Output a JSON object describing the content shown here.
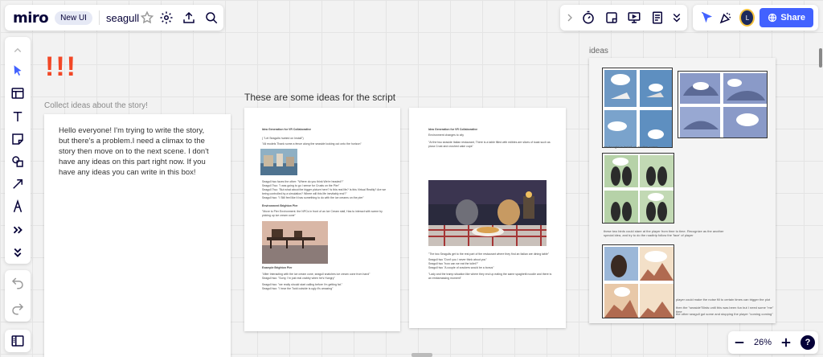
{
  "header": {
    "logo": "miro",
    "badge": "New UI",
    "board_name": "seagull"
  },
  "share": {
    "label": "Share"
  },
  "avatar": {
    "initial": "L"
  },
  "zoom": {
    "level": "26%"
  },
  "help": {
    "label": "?"
  },
  "canvas": {
    "exclaim": "!!!",
    "collect_caption": "Collect ideas about the story!",
    "script_caption": "These are some ideas for the script",
    "ideas_caption": "ideas",
    "sticky_text": "Hello everyone! I'm trying to write the story, but there's a problem.I need a climax to the story then move on to the next scene. I don't have any ideas on this part right now. If you have any ideas you can write in this box!"
  },
  "doc1": {
    "title": "Idea Generation for VR Collaborative",
    "l1": "( \"Let Seagulls hunted on Install\")",
    "l2": "\"All models Thank some a fence along the seaside looking out onto the horizon\"",
    "l3": "Seagull two faces the other: \"Where do you think We're headed?\"",
    "l4": "Seagull Two: \"I was going to go I sense for Crusts on the Pier\"",
    "l5": "Seagull Two: \"But what about the bigger picture here? Is this real life? Is this Virtual Reality? Are we",
    "l6": "being controlled by a simulation? Where will this life inevitably end?\"",
    "l7": "Seagull two: \"I Still feel like it has something to do with the ice creams on the pier\"",
    "section": "Environment Brighton Pier",
    "l8": "\"Move to Pier Environment. the NPCs in front of an Ice Cream stall, Has to interact with scene by",
    "l9": "picking up ice cream cone\"",
    "caption": "Example Brighton Pier",
    "l10": "\"After Interacting with the ice cream cone, seagull snatches ice cream cone from hand\"",
    "l11": "Seagull two: \"Sorry, I'm just real crabby when he's Hungry\"",
    "l12": "Seagull two: \"we really should start calling before I'm getting fat.\"",
    "l13": "Seagull two: \"I hear the Todd outside is ugly it's amazing\""
  },
  "doc2": {
    "title": "Idea Generation for VR Collaborative",
    "l1": "Environment changes to city",
    "l2": "\"At the two seaside Italian restaurant, There is a table filled with edibles are slices of toast such as",
    "l3": "pizza Crust and crushed cake cups\"",
    "l4": "\"The two Seagulls get to the rest part of the restaurant where they find an Italian are dining table\"",
    "l5": "Seagull two \"Don't you I never think about you\"",
    "l6": "Seagull two \"how can we eat the toilet?\"",
    "l7": "Seagull two \"A couple of crackers would be a bonus\"",
    "l8": "\"Lady and the tramp situation like where they end up eating the same spaghetti noodle and there is",
    "l9": "an embarrassing moment\""
  },
  "ideas": {
    "n1": "we thought in Install on another scene",
    "n2": "these two birds could stare at the player from time to time. Recognize as the another",
    "n3": "special idea, and try to do the roadtrip follow the 'face' of player",
    "n4": "player could make the noise fill to certain times can trigger the plot",
    "n5": "then the \"seaside\"Birds until this was been fun but I need some \"me\" time",
    "n6": "the other seagull got some and stopping the player \"coming coming\""
  },
  "colors": {
    "accent": "#4262ff",
    "exclaim": "#f24726",
    "avatar_ring": "#f5c23c"
  }
}
